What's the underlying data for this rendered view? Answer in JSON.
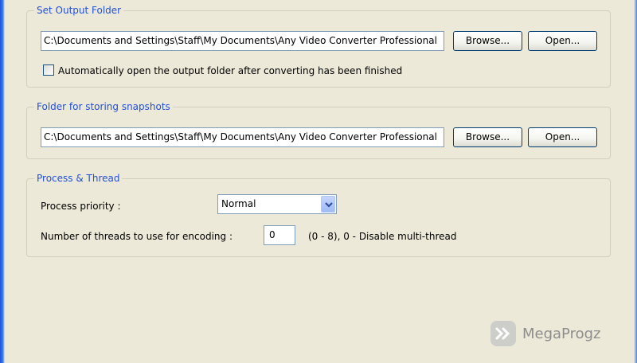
{
  "output_folder": {
    "title": "Set Output Folder",
    "path": "C:\\Documents and Settings\\Staff\\My Documents\\Any Video Converter Professional",
    "browse_label": "Browse...",
    "open_label": "Open...",
    "auto_open_label": "Automatically open the output folder after converting has been finished",
    "auto_open_checked": false
  },
  "snapshots_folder": {
    "title": "Folder for storing snapshots",
    "path": "C:\\Documents and Settings\\Staff\\My Documents\\Any Video Converter Professional",
    "browse_label": "Browse...",
    "open_label": "Open..."
  },
  "process_thread": {
    "title": "Process & Thread",
    "priority_label": "Process priority :",
    "priority_value": "Normal",
    "threads_label": "Number of threads to use for encoding :",
    "threads_value": "0",
    "threads_hint": "(0 - 8), 0 - Disable multi-thread"
  },
  "watermark": {
    "text": "MegaProgz"
  },
  "colors": {
    "group_title": "#2250d8",
    "background": "#ece9d8"
  }
}
